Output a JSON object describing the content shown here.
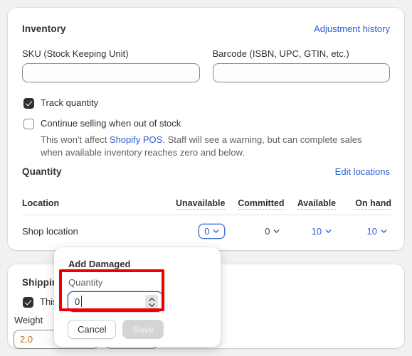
{
  "inventory": {
    "title": "Inventory",
    "adjustment_history_link": "Adjustment history",
    "sku_label": "SKU (Stock Keeping Unit)",
    "sku_value": "",
    "sku_placeholder": "",
    "barcode_label": "Barcode (ISBN, UPC, GTIN, etc.)",
    "barcode_value": "",
    "barcode_placeholder": "",
    "track_quantity_label": "Track quantity",
    "track_quantity_checked": true,
    "continue_selling_label": "Continue selling when out of stock",
    "continue_selling_checked": false,
    "helper_text_prefix": "This won't affect ",
    "helper_link": "Shopify POS",
    "helper_text_suffix": ". Staff will see a warning, but can complete sales when available inventory reaches zero and below.",
    "quantity_title": "Quantity",
    "edit_locations_link": "Edit locations"
  },
  "quantity_table": {
    "headers": {
      "location": "Location",
      "unavailable": "Unavailable",
      "committed": "Committed",
      "available": "Available",
      "on_hand": "On hand"
    },
    "rows": [
      {
        "location": "Shop location",
        "unavailable": "0",
        "committed": "0",
        "available": "10",
        "on_hand": "10"
      }
    ]
  },
  "shipping": {
    "title": "Shipping",
    "physical_product_label": "This is",
    "physical_product_checked": true,
    "weight_label": "Weight",
    "weight_value": "2.0"
  },
  "popover": {
    "title": "Add Damaged",
    "quantity_label": "Quantity",
    "quantity_value": "0",
    "cancel_label": "Cancel",
    "save_label": "Save"
  },
  "colors": {
    "link_blue": "#2c5ecf",
    "focus_blue": "#1b4fb0",
    "annotation_red": "#ee0000",
    "weight_orange": "#c2700b",
    "page_background": "#f1f1f1"
  }
}
